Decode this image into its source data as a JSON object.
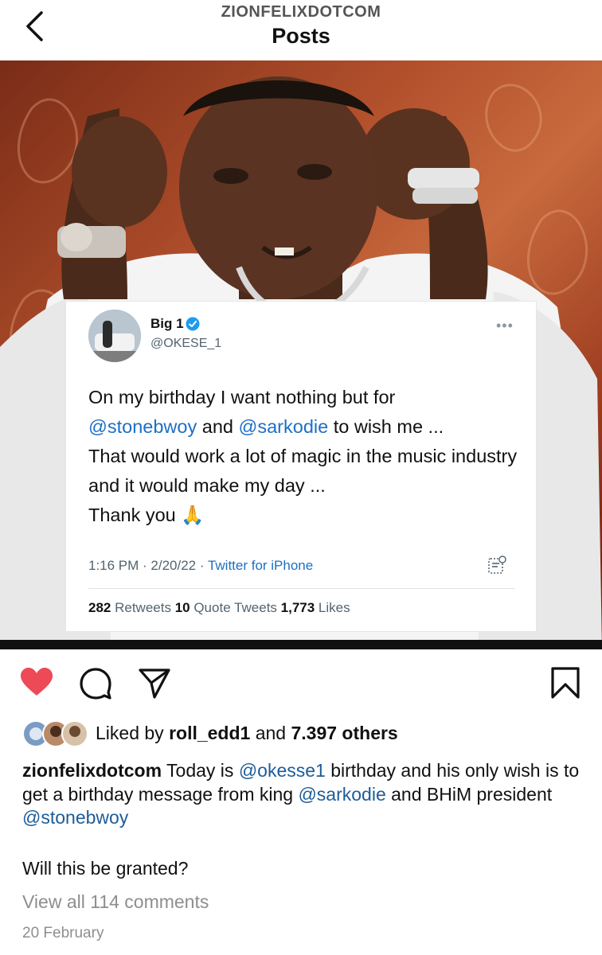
{
  "header": {
    "account": "ZIONFELIXDOTCOM",
    "title": "Posts"
  },
  "tweet": {
    "name": "Big 1",
    "handle": "@OKESE_1",
    "text_1": "On my birthday I want nothing but for",
    "mention_1": "@stonebwoy",
    "text_2": " and ",
    "mention_2": "@sarkodie",
    "text_3": " to wish me ...",
    "text_4": "That would work a lot of magic in the music industry and it would make my day ...",
    "text_5": "Thank you",
    "emoji": "🙏",
    "time": "1:16 PM · 2/20/22 · ",
    "source": "Twitter for iPhone",
    "retweets_count": "282",
    "retweets_label": " Retweets ",
    "quotes_count": "10",
    "quotes_label": " Quote Tweets ",
    "likes_count": "1,773",
    "likes_label": " Likes",
    "more": "•••"
  },
  "likes": {
    "prefix": "Liked by ",
    "user": "roll_edd1",
    "middle": " and ",
    "others": "7.397 others"
  },
  "caption": {
    "user": "zionfelixdotcom",
    "text_1": " Today is ",
    "mention_1": "@okesse1",
    "text_2": " birthday and his only wish is to get a birthday message from king ",
    "mention_2": "@sarkodie",
    "text_3": " and BHiM president ",
    "mention_3": "@stonebwoy",
    "line_2": "Will this be granted?"
  },
  "comments_link": "View all 114 comments",
  "date": "20 February",
  "colors": {
    "heart": "#ed4956",
    "link": "#1d6fc4",
    "muted": "#8e8e8e"
  },
  "icons": [
    "back-icon",
    "heart-icon",
    "comment-icon",
    "share-icon",
    "bookmark-icon",
    "verified-icon",
    "tweet-more-icon"
  ]
}
